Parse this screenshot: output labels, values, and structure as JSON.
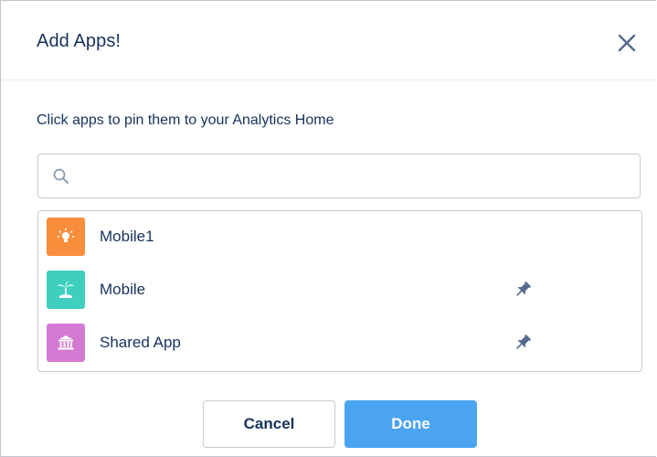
{
  "dialog": {
    "title": "Add Apps!",
    "instruction": "Click apps to pin them to your Analytics Home",
    "close_icon": "close-icon"
  },
  "search": {
    "value": "",
    "placeholder": "",
    "icon": "search-icon"
  },
  "apps": [
    {
      "name": "Mobile1",
      "icon": "lightbulb-icon",
      "color": "#f88e3c",
      "pinned": false
    },
    {
      "name": "Mobile",
      "icon": "island-icon",
      "color": "#3fcfbf",
      "pinned": true
    },
    {
      "name": "Shared App",
      "icon": "bank-icon",
      "color": "#d57ad3",
      "pinned": true
    }
  ],
  "footer": {
    "cancel_label": "Cancel",
    "done_label": "Done"
  },
  "colors": {
    "primary": "#4ba4f0",
    "text": "#16325c",
    "border": "#c6ccd4",
    "pin": "#54698d"
  }
}
